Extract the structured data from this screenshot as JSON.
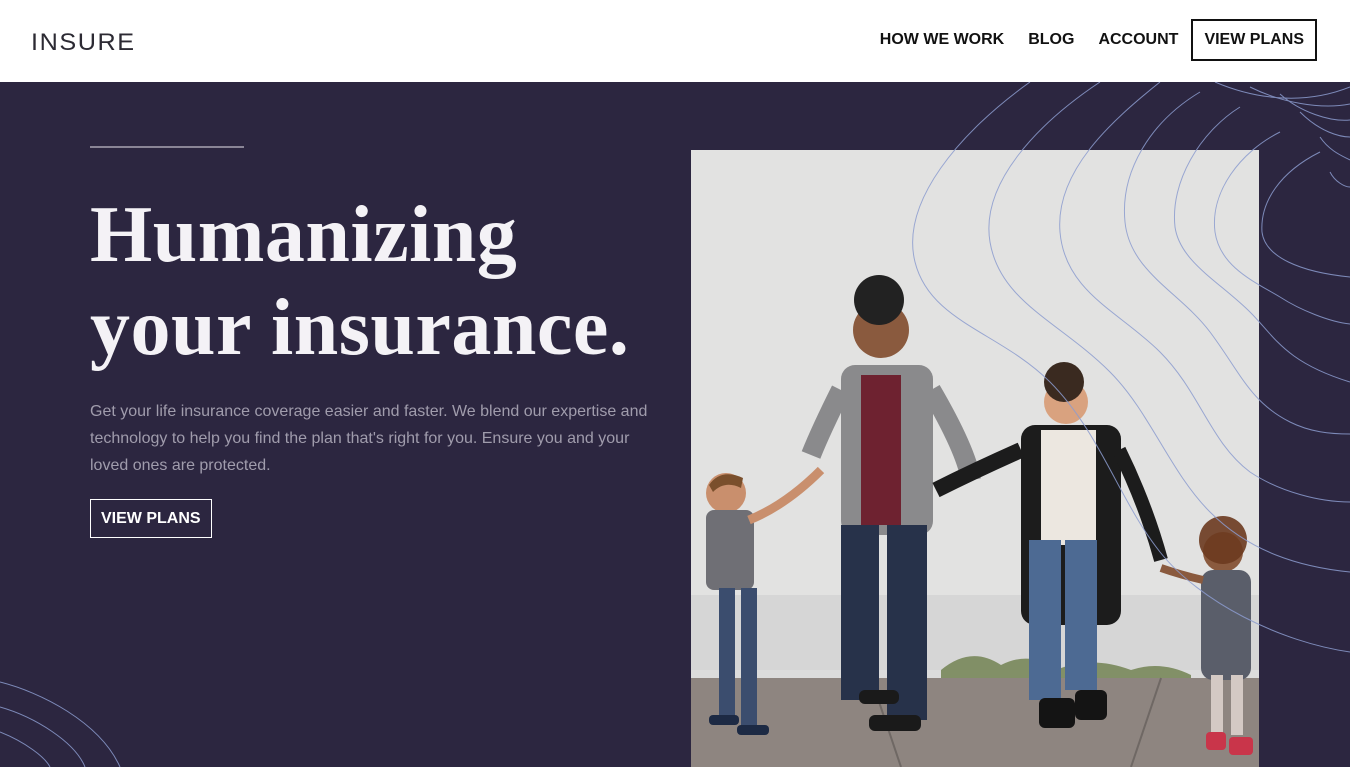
{
  "header": {
    "logo": "INSURE",
    "nav": [
      {
        "label": "HOW WE WORK"
      },
      {
        "label": "BLOG"
      },
      {
        "label": "ACCOUNT"
      }
    ],
    "cta": "VIEW PLANS"
  },
  "hero": {
    "title_line1": "Humanizing",
    "title_line2": "your insurance.",
    "description": "Get your life insurance coverage easier and faster. We blend our expertise and technology to help you find the plan that's right for you. Ensure you and your loved ones are protected.",
    "cta": "VIEW PLANS",
    "image_alt": "family-walking-photo"
  },
  "colors": {
    "hero_bg": "#2c2640",
    "header_bg": "#ffffff",
    "accent_lines": "#8c9ccf"
  }
}
